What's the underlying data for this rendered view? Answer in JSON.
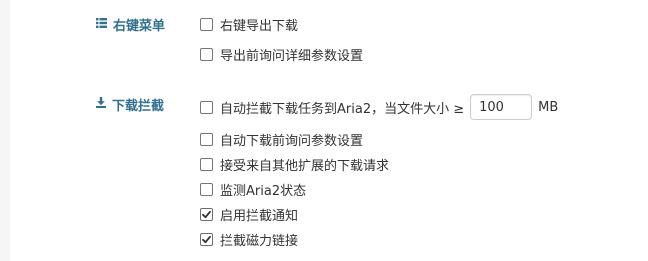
{
  "context_menu_section": {
    "label": "右键菜单",
    "icon": "list-icon",
    "options": [
      {
        "label": "右键导出下载",
        "checked": false
      },
      {
        "label": "导出前询问详细参数设置",
        "checked": false
      }
    ]
  },
  "download_intercept_section": {
    "label": "下载拦截",
    "icon": "download-icon",
    "size_option": {
      "label": "自动拦截下载任务到Aria2，当文件大小 ≥",
      "value": "100",
      "unit": "MB",
      "checked": false
    },
    "options": [
      {
        "label": "自动下载前询问参数设置",
        "checked": false
      },
      {
        "label": "接受来自其他扩展的下载请求",
        "checked": false
      },
      {
        "label": "监测Aria2状态",
        "checked": false
      },
      {
        "label": "启用拦截通知",
        "checked": true
      },
      {
        "label": "拦截磁力链接",
        "checked": true
      }
    ]
  },
  "colors": {
    "section_label": "#31708f",
    "text": "#333333",
    "background": "#f6f6f6",
    "panel": "#ffffff"
  }
}
